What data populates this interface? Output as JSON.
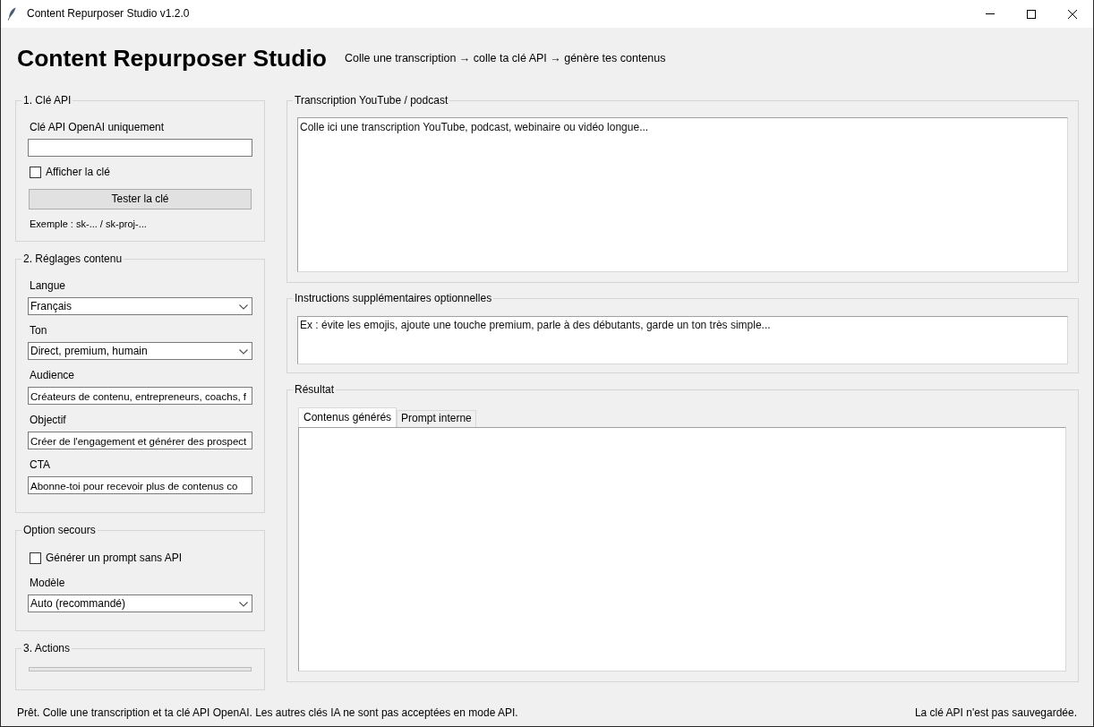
{
  "window": {
    "title": "Content Repurposer Studio v1.2.0"
  },
  "header": {
    "title": "Content Repurposer Studio",
    "subtitle": "Colle une transcription → colle ta clé API → génère tes contenus"
  },
  "api_section": {
    "title": "1. Clé API",
    "key_label": "Clé API OpenAI uniquement",
    "show_key": {
      "label": "Afficher la clé",
      "checked": false
    },
    "test_button": "Tester la clé",
    "example": "Exemple : sk-... / sk-proj-..."
  },
  "settings_section": {
    "title": "2. Réglages contenu",
    "fields": [
      {
        "kind": "dropdown",
        "label": "Langue",
        "value": "Français"
      },
      {
        "kind": "dropdown",
        "label": "Ton",
        "value": "Direct, premium, humain"
      },
      {
        "kind": "entry",
        "label": "Audience",
        "value": "Créateurs de contenu, entrepreneurs, coachs, f"
      },
      {
        "kind": "entry",
        "label": "Objectif",
        "value": "Créer de l'engagement et générer des prospect"
      },
      {
        "kind": "entry",
        "label": "CTA",
        "value": "Abonne-toi pour recevoir plus de contenus co"
      }
    ]
  },
  "fallback_section": {
    "title": "Option secours",
    "prompt_without_api": {
      "label": "Générer un prompt sans API",
      "checked": false
    },
    "model": {
      "label": "Modèle",
      "value": "Auto (recommandé)"
    }
  },
  "actions_section": {
    "title": "3. Actions",
    "progress": {
      "level": 0
    }
  },
  "transcript_section": {
    "title": "Transcription YouTube / podcast",
    "placeholder": "Colle ici une transcription YouTube, podcast, webinaire ou vidéo longue..."
  },
  "instructions_section": {
    "title": "Instructions supplémentaires optionnelles",
    "placeholder": "Ex : évite les emojis, ajoute une touche premium, parle à des débutants, garde un ton très simple..."
  },
  "result_section": {
    "title": "Résultat",
    "tabs": [
      {
        "label": "Contenus générés",
        "selected": true
      },
      {
        "label": "Prompt interne",
        "selected": false
      }
    ]
  },
  "status_bar": {
    "message": "Prêt. Colle une transcription et ta clé API OpenAI. Les autres clés IA ne sont pas acceptées en mode API.",
    "note": "La clé API n'est pas sauvegardée."
  }
}
